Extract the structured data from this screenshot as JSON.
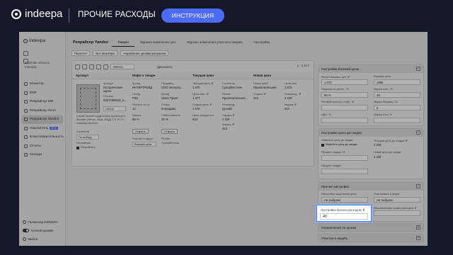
{
  "header": {
    "brand": "indeepa",
    "section_title": "ПРОЧИЕ РАСХОДЫ",
    "instruction_button": "ИНСТРУКЦИЯ"
  },
  "sidebar": {
    "logo": "indeepa",
    "workspace_label": "Рабочая область",
    "workspace_value": "Indeepa",
    "items": [
      {
        "label": "Монитор"
      },
      {
        "label": "ERP"
      },
      {
        "label": "Репрайсер WB"
      },
      {
        "label": "Репрайсер Ozon"
      },
      {
        "label": "Репрайсер Yandex"
      },
      {
        "label": "Накопитель",
        "badge": "NEW"
      },
      {
        "label": "Благотворительность"
      },
      {
        "label": "Отчеты"
      },
      {
        "label": "Склады"
      }
    ],
    "bottom": [
      {
        "label": "Промокод INDEEPA"
      },
      {
        "label": "Ночной дизайн"
      },
      {
        "label": "Выйти"
      }
    ]
  },
  "main": {
    "title": "Репрайсер Yandex",
    "tabs": [
      "Товары",
      "Журнал изменения цен",
      "Журнал изменения участия в акциях",
      "Настройки"
    ],
    "filters": [
      "Пересчет",
      "Все визитёры",
      "Управление ценами магазинов"
    ],
    "toolbar": {
      "search_value": "250411",
      "dates_label": "Диапазоны",
      "pager": "1 - 1   из 1"
    },
    "table": {
      "headers": [
        "Артикул",
        "Инфо о товаре",
        "Текущая цена",
        "Новая цена"
      ],
      "row": {
        "article_label": "Артикул",
        "article_value": "Исторические карты",
        "sku_label": "Отслеж.",
        "sku_value": "8267/009525_и...",
        "sku_short": "250411",
        "name": "Схема тонкой нордсталята транспорта Москвы (Метро, МЦК, МЦД) С.Е.П.Г.Н., ламинированная",
        "strategy_label": "Стратегия",
        "strategy_value": "По выбору",
        "repricing_label": "Репрайсинг",
        "repricing_value": "Репрайсить",
        "info": {
          "brand_label": "Бренд",
          "brand_value": "ИНТЕРТРЕЙД",
          "seller_label": "Продавец",
          "seller_value": "ООО Интертр...",
          "store_label": "Склад",
          "store_value": "FBS",
          "type_label": "Бренд",
          "type_value": "Илюс Принт",
          "stock_label": "Остаток на ск.",
          "stock_value": "14",
          "status_label": "Статус",
          "status_value": "В продаже",
          "margin_label": "Маржа",
          "margin_value": "88 %",
          "cost_label": "Себестоимость",
          "cost_value": "25 %",
          "open_button": "Открыть",
          "fulfilment_label": "Участие в акции",
          "fulfilment_value": "Базовая цена",
          "mode_label": "Регион",
          "mode_value": "СуперВестник"
        },
        "current": {
          "price_label": "Текущая цена, ₽",
          "price_value": "1 570",
          "min_label": "Цена мин., ₽",
          "min_value": "1 377",
          "old_label": "Старая цена, ₽",
          "old_value": "1 570",
          "comp_label": "Цена конкурента",
          "comp_value": "613",
          "strategy_label": "Стратегия",
          "strategy_value": "СуперВестник",
          "mode_label": "Режим",
          "mode_value": "Прилипательная...",
          "manual_label": "Рекоменд.",
          "manual_value": "ручной",
          "new_price_label": "Скидка, ₽",
          "new_price_value": "2 220",
          "margin_label": "Маржа, ₽",
          "margin_value": "613"
        },
        "new": {
          "price_label": "Новая цена",
          "price_value": "Прилипательная",
          "min_label": "Цена мин.",
          "min_value": "1 570",
          "old_label": "Старая, ₽",
          "old_value": "613",
          "rec_label": "Рекоменд., ₽",
          "rec_value": "2 220",
          "margin_label": "Маржа, ₽",
          "margin_value": "613"
        }
      }
    }
  },
  "right_panel": {
    "sections": [
      {
        "title": "Настройки базовой цены",
        "fields": [
          {
            "label": "Расчет базовых цен, ₽",
            "value": "1 670"
          },
          {
            "label": "Базовая цена",
            "value": "1980"
          },
          {
            "label": "Наценка по умолч., %",
            "value": "88 %"
          },
          {
            "label": "Маржа мин., %",
            "value": "40"
          },
          {
            "label": "Рентабельность с НДС, %",
            "value": ""
          },
          {
            "label": "Маржа базовая, %",
            "value": "0"
          },
          {
            "label": "НДС, %",
            "value": ""
          },
          {
            "label": "Маржа итог, %",
            "value": ""
          }
        ]
      },
      {
        "title": "Настройки цены до скидки",
        "fields": [
          {
            "label": "Изменить цену до скидки",
            "value": "Изменять цену до скидки"
          },
          {
            "label": "Текущая цена до скидки, ₽",
            "value": "2 226"
          },
          {
            "label": "Процент скидки, %",
            "value": ""
          },
          {
            "label": "Новая цена до скидки",
            "value": "2 226"
          },
          {
            "label": "Процент скидки",
            "value": ""
          }
        ]
      },
      {
        "title": "Прочие настройки",
        "fields": [
          {
            "label": "Настройка округления цены",
            "value": "Не выбрано"
          },
          {
            "label": "Участвовать в акции",
            "value": "Не выбрано"
          },
          {
            "label": "Настройка прочих расходов, ₽",
            "value": "40"
          },
          {
            "label": "Максимальная сумма расходов, ₽",
            "value": ""
          }
        ]
      },
      {
        "title": "Ограничения по ценам"
      },
      {
        "title": "Участие в акциях"
      }
    ],
    "highlighted": {
      "label": "Настройка прочих расходов, ₽",
      "value": "40"
    }
  }
}
